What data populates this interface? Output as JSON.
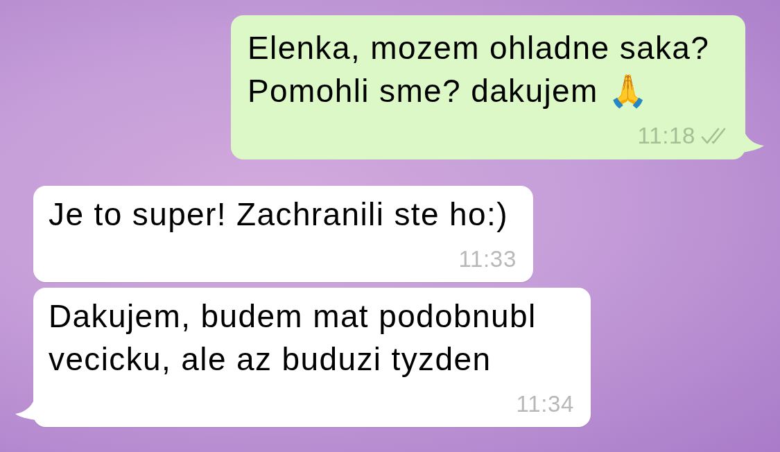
{
  "messages": [
    {
      "kind": "outgoing",
      "text": "Elenka, mozem ohladne saka? Pomohli sme? dakujem 🙏",
      "time": "11:18",
      "read": false
    },
    {
      "kind": "incoming",
      "text": "Je to super! Zachranili ste ho:)",
      "time": "11:33"
    },
    {
      "kind": "incoming",
      "text": "Dakujem, budem mat podobnubl vecicku, ale az buduzi tyzden",
      "time": "11:34"
    }
  ]
}
